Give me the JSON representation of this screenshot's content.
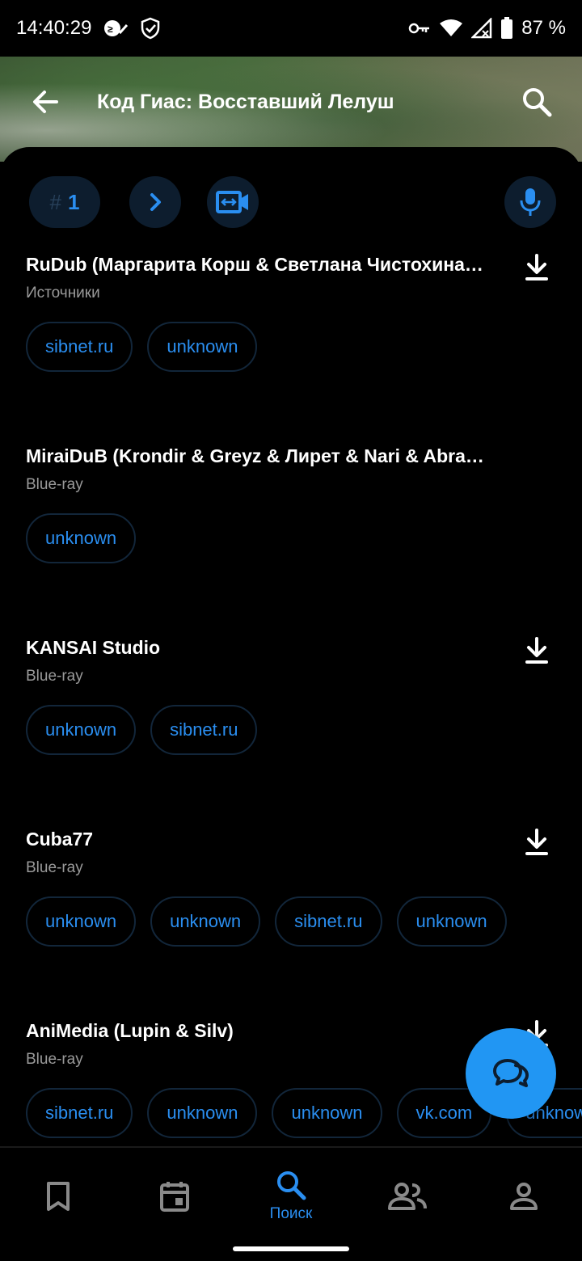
{
  "status_bar": {
    "time": "14:40:29",
    "battery": "87 %"
  },
  "header": {
    "title": "Код Гиас: Восставший Лелуш"
  },
  "controls": {
    "episode_hash": "#",
    "episode_number": "1"
  },
  "releases": [
    {
      "name": "RuDub (Маргарита Корш & Светлана Чистохина…",
      "subtitle": "Источники",
      "has_download": true,
      "tags": [
        "sibnet.ru",
        "unknown"
      ]
    },
    {
      "name": "MiraiDuB (Krondir & Greyz & Лирет & Nari & Abrah…",
      "subtitle": "Blue-ray",
      "has_download": false,
      "tags": [
        "unknown"
      ]
    },
    {
      "name": "KANSAI Studio",
      "subtitle": "Blue-ray",
      "has_download": true,
      "tags": [
        "unknown",
        "sibnet.ru"
      ]
    },
    {
      "name": "Cuba77",
      "subtitle": "Blue-ray",
      "has_download": true,
      "tags": [
        "unknown",
        "unknown",
        "sibnet.ru",
        "unknown"
      ]
    },
    {
      "name": "AniMedia (Lupin & Silv)",
      "subtitle": "Blue-ray",
      "has_download": true,
      "tags": [
        "sibnet.ru",
        "unknown",
        "unknown",
        "vk.com",
        "unknown"
      ]
    }
  ],
  "bottom_nav": {
    "items": [
      {
        "icon": "bookmark-icon"
      },
      {
        "icon": "calendar-icon"
      },
      {
        "icon": "search-icon",
        "label": "Поиск",
        "active": true
      },
      {
        "icon": "friends-icon"
      },
      {
        "icon": "profile-icon"
      }
    ]
  },
  "colors": {
    "accent": "#2196f3",
    "accent_text": "#2a8ef0",
    "chip_bg": "#0d1d2e",
    "background": "#000000"
  }
}
